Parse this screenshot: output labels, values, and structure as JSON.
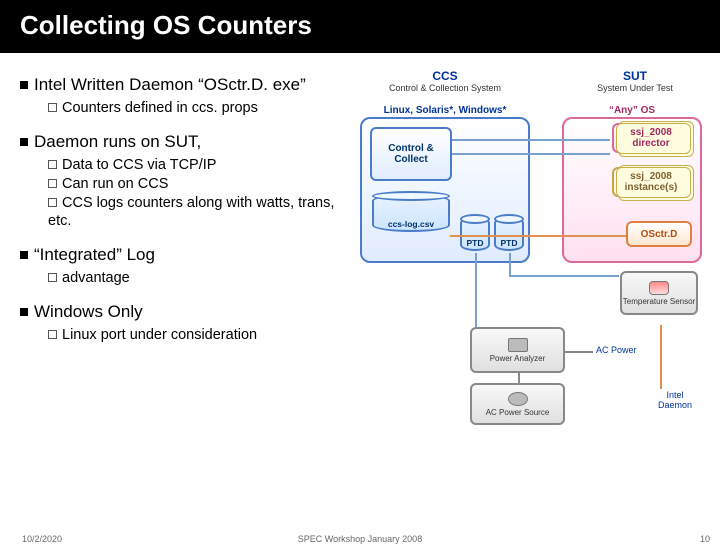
{
  "title": "Collecting OS Counters",
  "bullets": {
    "b1": "Intel Written Daemon “OSctr.D. exe”",
    "b1a": "Counters defined in ccs. props",
    "b2": "Daemon runs on SUT,",
    "b2a": "Data to CCS via TCP/IP",
    "b2b": "Can run on CCS",
    "b2c": "CCS logs counters along with watts, trans, etc.",
    "b3": "“Integrated” Log",
    "b3a": "advantage",
    "b4": "Windows Only",
    "b4a": "Linux port under consideration"
  },
  "diagram": {
    "ccs": {
      "title": "CCS",
      "sub": "Control & Collection System"
    },
    "sut": {
      "title": "SUT",
      "sub": "System Under Test"
    },
    "os_left": "Linux, Solaris*, Windows*",
    "os_right": "“Any” OS",
    "control_collect": "Control & Collect",
    "ssj_director": "ssj_2008 director",
    "ssj_instances": "ssj_2008 instance(s)",
    "csv": "ccs-log.csv",
    "ptd": "PTD",
    "osctrd": "OSctr.D",
    "temp_sensor": "Temperature Sensor",
    "power_analyzer": "Power Analyzer",
    "ac_source": "AC Power Source",
    "ac_power_lbl": "AC Power",
    "intel_daemon_lbl": "Intel Daemon"
  },
  "footer": {
    "date": "10/2/2020",
    "mid": "SPEC Workshop January 2008",
    "page": "10"
  }
}
